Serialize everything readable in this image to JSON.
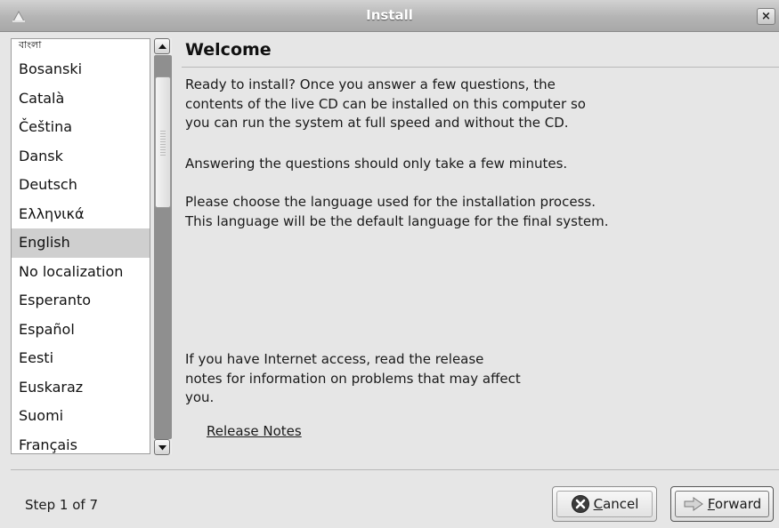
{
  "window": {
    "title": "Install",
    "close_glyph": "×"
  },
  "language_list": {
    "items": [
      "বাংলা",
      "Bosanski",
      "Català",
      "Čeština",
      "Dansk",
      "Deutsch",
      "Ελληνικά",
      "English",
      "No localization",
      "Esperanto",
      "Español",
      "Eesti",
      "Euskaraz",
      "Suomi",
      "Français"
    ],
    "selected": "English"
  },
  "main": {
    "heading": "Welcome",
    "paragraph1_lines": [
      "Ready to install? Once you answer a few questions, the",
      "contents of the live CD can be installed on this computer so",
      "you can run the system at full speed and without the CD."
    ],
    "paragraph2": "Answering the questions should only take a few minutes.",
    "paragraph3_lines": [
      "Please choose the language used for the installation process.",
      "This language will be the default language for the final system."
    ],
    "internet_lines": [
      "If you have Internet access, read the release",
      "notes for information on problems that may affect",
      "you."
    ],
    "release_notes_link": "Release Notes"
  },
  "footer": {
    "step_text": "Step 1 of 7",
    "cancel": {
      "mnemonic": "C",
      "rest": "ancel",
      "icon": "cancel-icon"
    },
    "forward": {
      "mnemonic": "F",
      "rest": "orward",
      "icon": "forward-arrow-icon"
    }
  }
}
